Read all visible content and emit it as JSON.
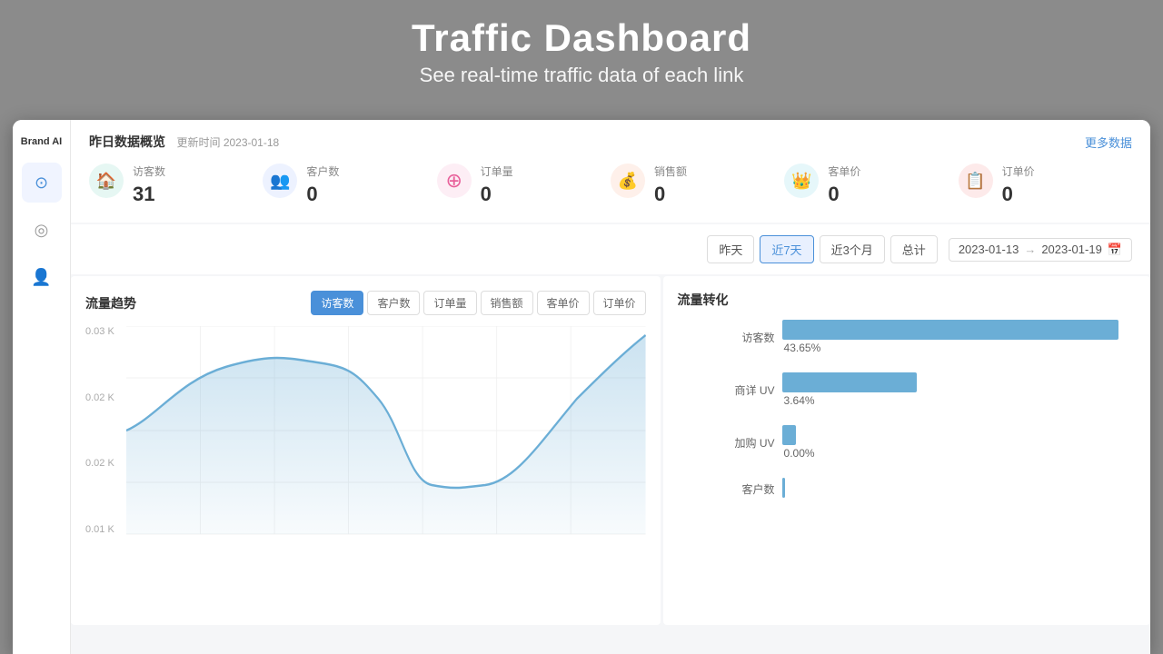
{
  "header": {
    "title": "Traffic Dashboard",
    "subtitle": "See real-time traffic data of each link"
  },
  "sidebar": {
    "brand": "Brand AI",
    "items": [
      {
        "label": "dashboard",
        "icon": "⊙",
        "active": true
      },
      {
        "label": "analytics",
        "icon": "◎",
        "active": false
      },
      {
        "label": "users",
        "icon": "👤",
        "active": false
      }
    ]
  },
  "overview": {
    "title": "昨日数据概览",
    "update_label": "更新时间",
    "update_date": "2023-01-18",
    "more_data": "更多数据",
    "stats": [
      {
        "label": "访客数",
        "value": "31",
        "icon_color": "#4cb8a0",
        "icon_bg": "#e6f7f3",
        "icon": "🏠"
      },
      {
        "label": "客户数",
        "value": "0",
        "icon_color": "#5b8ef0",
        "icon_bg": "#edf2ff",
        "icon": "👥"
      },
      {
        "label": "订单量",
        "value": "0",
        "icon_color": "#e8609a",
        "icon_bg": "#fdeef5",
        "icon": "⊕"
      },
      {
        "label": "销售额",
        "value": "0",
        "icon_color": "#e87c50",
        "icon_bg": "#fef0ea",
        "icon": "💰"
      },
      {
        "label": "客单价",
        "value": "0",
        "icon_color": "#3ab8c8",
        "icon_bg": "#e6f7fa",
        "icon": "👑"
      },
      {
        "label": "订单价",
        "value": "0",
        "icon_color": "#e85252",
        "icon_bg": "#fdeaea",
        "icon": "📋"
      }
    ]
  },
  "filters": {
    "buttons": [
      "昨天",
      "近7天",
      "近3个月",
      "总计"
    ],
    "active_button": "近7天",
    "date_start": "2023-01-13",
    "date_arrow": "→",
    "date_end": "2023-01-19",
    "calendar_icon": "📅"
  },
  "trend_chart": {
    "title": "流量趋势",
    "tabs": [
      "访客数",
      "客户数",
      "订单量",
      "销售额",
      "客单价",
      "订单价"
    ],
    "active_tab": "访客数",
    "y_labels": [
      "0.03 K",
      "0.02 K",
      "0.02 K",
      "0.01 K"
    ]
  },
  "conversion_chart": {
    "title": "流量转化",
    "bars": [
      {
        "label": "访客数",
        "width_pct": 95,
        "percent": "43.65%"
      },
      {
        "label": "商详 UV",
        "width_pct": 38,
        "percent": "3.64%"
      },
      {
        "label": "加购 UV",
        "width_pct": 5,
        "percent": "0.00%"
      },
      {
        "label": "客户数",
        "width_pct": 0,
        "percent": ""
      }
    ]
  }
}
